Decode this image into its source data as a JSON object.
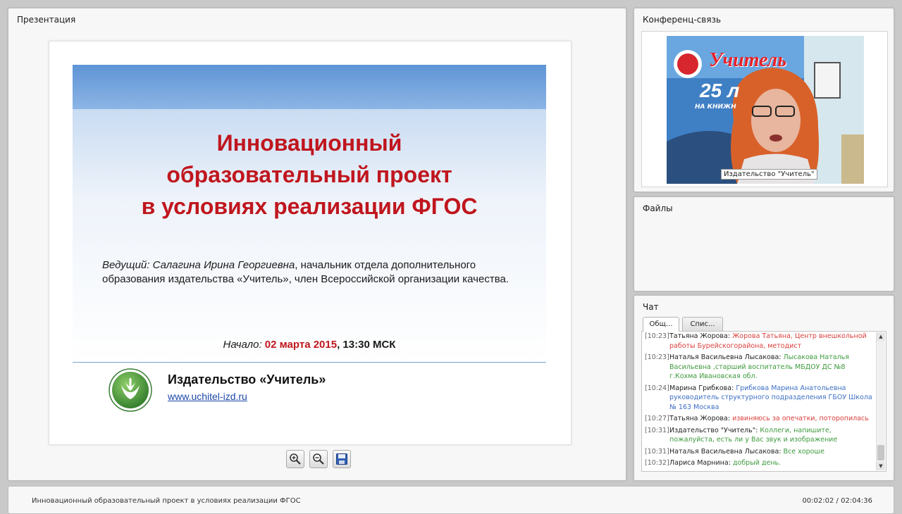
{
  "panels": {
    "presentation_title": "Презентация",
    "conference_title": "Конференц-связь",
    "files_title": "Файлы",
    "chat_title": "Чат"
  },
  "slide": {
    "title": "Инновационный\nобразовательный проект\nв условиях реализации ФГОС",
    "host_lead": "Ведущий: Салагина Ирина Георгиевна",
    "host_rest": ", начальник отдела дополнительного образования издательства «Учитель», член Всероссийской организации качества.",
    "start_label": "Начало: ",
    "start_date": "02 марта 2015",
    "start_time": ", 13:30 МСК",
    "publisher": "Издательство «Учитель»",
    "url": "www.uchitel-izd.ru"
  },
  "toolbar": {
    "zoom_in_icon": "zoom-in-icon",
    "zoom_out_icon": "zoom-out-icon",
    "save_icon": "save-icon"
  },
  "video": {
    "caption": "Издательство \"Учитель\"",
    "banner_text": "Учитель",
    "banner_sub": "25 л",
    "banner_sub2": "НА КНИЖН"
  },
  "chat": {
    "tabs": [
      "Общ...",
      "Спис..."
    ],
    "messages": [
      {
        "time": "[10:23]",
        "author": "Татьяна Жорова:",
        "text": "Жорова Татьяна, Центр внешкольной работы Бурейскогорайона, методист",
        "color": "red"
      },
      {
        "time": "[10:23]",
        "author": "Наталья Васильевна Лысакова:",
        "text": "Лысакова Наталья Васильевна ,старший воспитатель МБДОУ ДС №8 г.Кохма Ивановская обл.",
        "color": "green"
      },
      {
        "time": "[10:24]",
        "author": "Марина Грибкова:",
        "text": "Грибкова Марина Анатольевна руководитель структурного подразделения ГБОУ Школа № 163 Москва",
        "color": "blue"
      },
      {
        "time": "[10:27]",
        "author": "Татьяна Жорова:",
        "text": "извиняюсь за опечатки, поторопилась",
        "color": "red"
      },
      {
        "time": "[10:31]",
        "author": "Издательство \"Учитель\":",
        "text": "Коллеги, напишите, пожалуйста, есть ли у Вас звук и изображение",
        "color": "green"
      },
      {
        "time": "[10:31]",
        "author": "Наталья Васильевна Лысакова:",
        "text": "Все хороше",
        "color": "green"
      },
      {
        "time": "[10:32]",
        "author": "Лариса Марнина:",
        "text": "добрый день.",
        "color": "green"
      }
    ]
  },
  "footer": {
    "title": "Инновационный образовательный проект в условиях реализации ФГОС",
    "time": "00:02:02 / 02:04:36"
  },
  "colors": {
    "slide_title": "#c0161e",
    "header_bar": "#5e94d6",
    "link": "#1b46a8"
  }
}
